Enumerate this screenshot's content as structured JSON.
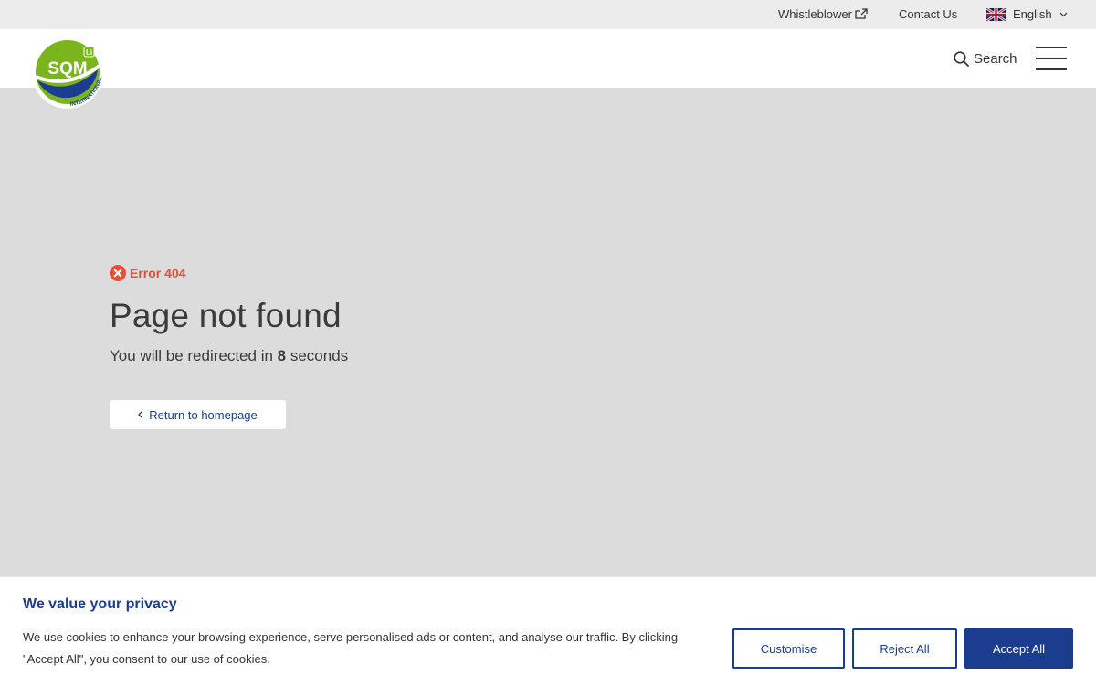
{
  "utility": {
    "whistleblower": "Whistleblower",
    "contact": "Contact Us",
    "language": "English"
  },
  "header": {
    "logo_text": "SQM",
    "logo_subtext": "INTERNATIONAL",
    "search_label": "Search"
  },
  "main": {
    "error_label": "Error 404",
    "title": "Page not found",
    "redirect_prefix": "You will be redirected in ",
    "redirect_seconds": "8",
    "redirect_suffix": " seconds",
    "return_label": "Return to homepage"
  },
  "cookie": {
    "title": "We value your privacy",
    "text": "We use cookies to enhance your browsing experience, serve personalised ads or content, and analyse our traffic. By clicking \"Accept All\", you consent to our use of cookies.",
    "customise": "Customise",
    "reject": "Reject All",
    "accept": "Accept All"
  },
  "colors": {
    "brand_blue": "#1b3c8f",
    "brand_green": "#7ab51d",
    "error_red": "#e94e35",
    "background": "#dcdcdc"
  },
  "icons": [
    "external-link-icon",
    "uk-flag-icon",
    "chevron-down-icon",
    "search-icon",
    "menu-icon",
    "error-circle-icon",
    "chevron-left-icon"
  ]
}
